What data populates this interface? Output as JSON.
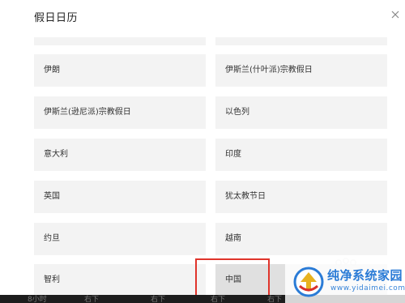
{
  "dialog": {
    "title": "假日日历",
    "close_icon": "close-icon"
  },
  "calendars": {
    "partial_left": "",
    "partial_right": "",
    "rows": [
      {
        "left": "伊朗",
        "right": "伊斯兰(什叶派)宗教假日"
      },
      {
        "left": "伊斯兰(逊尼派)宗教假日",
        "right": "以色列"
      },
      {
        "left": "意大利",
        "right": "印度"
      },
      {
        "left": "英国",
        "right": "犹太教节日"
      },
      {
        "left": "约旦",
        "right": "越南"
      },
      {
        "left": "智利",
        "right": "中国"
      }
    ],
    "selected": "中国"
  },
  "bottom_strip": {
    "fragments": [
      "8小时",
      "右下",
      "右下",
      "右下",
      "右下"
    ]
  },
  "watermark": {
    "title": "纯净系统家园",
    "url": "www.yidaimei.com"
  },
  "colors": {
    "highlight": "#e0342b",
    "cell_bg": "#f3f3f3",
    "selected_bg": "#e0e0e0",
    "watermark_blue": "#2a7bd6"
  }
}
